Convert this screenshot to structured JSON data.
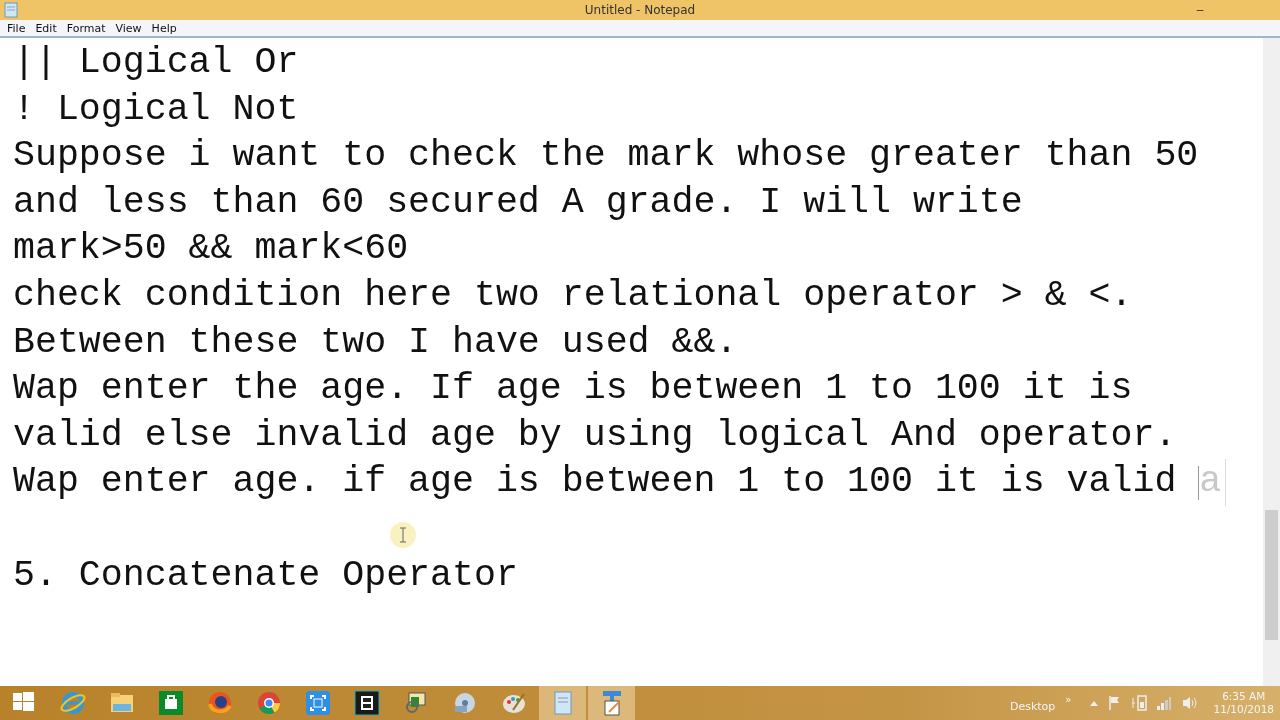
{
  "window": {
    "title": "Untitled - Notepad",
    "minimize": "–"
  },
  "menu": [
    "File",
    "Edit",
    "Format",
    "View",
    "Help"
  ],
  "lines": [
    {
      "text": "|| Logical Or"
    },
    {
      "text": "! Logical Not"
    },
    {
      "text": "Suppose i want to check the mark whose greater than 50"
    },
    {
      "text": "and less than 60 secured A grade. I will write"
    },
    {
      "text": "mark>50 && mark<60"
    },
    {
      "text": "check condition here two relational operator > & <."
    },
    {
      "text": "Between these two I have used &&."
    },
    {
      "text": "Wap enter the age. If age is between 1 to 100 it is"
    },
    {
      "text": "valid else invalid age by using logical And operator."
    },
    {
      "text": "Wap enter age. if age is between 1 to 100 it is valid ",
      "suggestion": "a"
    },
    {
      "text": "5. Concatenate Operator",
      "blank_before": true
    }
  ],
  "taskbar": {
    "apps": [
      {
        "kind": "windows",
        "active": false
      },
      {
        "kind": "ie",
        "active": false
      },
      {
        "kind": "folder",
        "active": false
      },
      {
        "kind": "store",
        "active": false
      },
      {
        "kind": "firefox",
        "active": false
      },
      {
        "kind": "chrome",
        "active": false
      },
      {
        "kind": "capture",
        "active": false
      },
      {
        "kind": "film",
        "active": false
      },
      {
        "kind": "mail",
        "active": false
      },
      {
        "kind": "disc",
        "active": false
      },
      {
        "kind": "paint",
        "active": false
      },
      {
        "kind": "notepad",
        "active": true
      },
      {
        "kind": "editor",
        "active": true
      }
    ],
    "desktop": "Desktop",
    "chevron": "»",
    "time": "6:35 AM",
    "date": "11/10/2018"
  }
}
